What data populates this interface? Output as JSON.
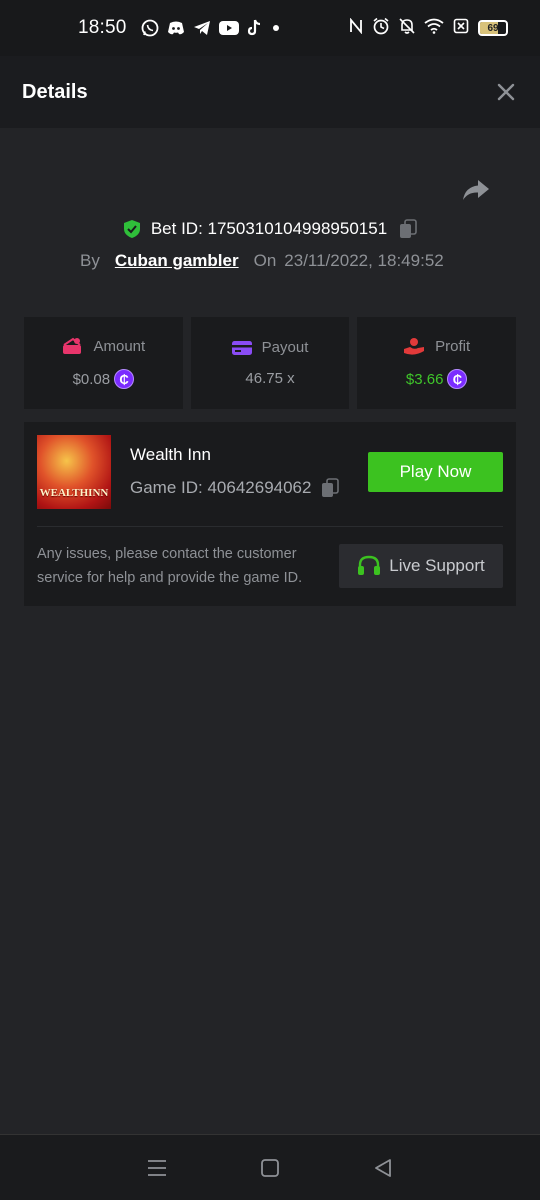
{
  "status_bar": {
    "time": "18:50",
    "battery": "69",
    "battery_level": 0.69,
    "app_icons": [
      "whatsapp-icon",
      "discord-icon",
      "telegram-icon",
      "youtube-icon",
      "tiktok-icon"
    ],
    "system_icons": [
      "nfc-icon",
      "alarm-icon",
      "mute-icon",
      "wifi-icon",
      "no-sim-icon",
      "battery-icon"
    ]
  },
  "header": {
    "title": "Details"
  },
  "bet": {
    "id_label": "Bet ID: 1750310104998950151",
    "by_label": "By",
    "username": "Cuban gambler",
    "on_label": "On",
    "date": "23/11/2022, 18:49:52"
  },
  "stats": [
    {
      "label": "Amount",
      "value": "$0.08",
      "icon": "amount-icon"
    },
    {
      "label": "Payout",
      "value": "46.75 x",
      "icon": "card-icon"
    },
    {
      "label": "Profit",
      "value": "$3.66",
      "icon": "profit-icon"
    }
  ],
  "game": {
    "name": "Wealth Inn",
    "id_label": "Game ID: 40642694062",
    "thumb_text": "WEALTHINN",
    "play_label": "Play Now",
    "help_text": "Any issues, please contact the customer service for help and provide the game ID.",
    "support_label": "Live Support"
  },
  "colors": {
    "accent_green": "#3cc220",
    "coin_purple": "#7b2cff",
    "background": "#232427",
    "card": "#1a1b1d"
  }
}
